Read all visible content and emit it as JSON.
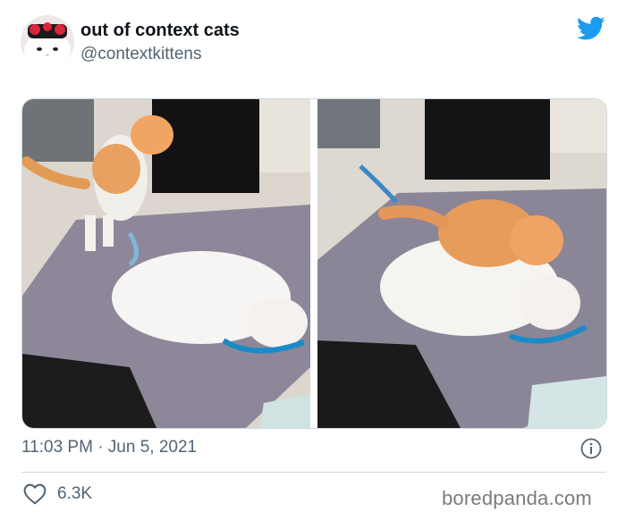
{
  "tweet": {
    "display_name": "out of context cats",
    "handle": "@contextkittens",
    "timestamp": "11:03 PM · Jun 5, 2021",
    "like_count": "6.3K"
  },
  "icons": {
    "brand": "twitter-bird-icon",
    "info": "info-circle-icon",
    "like": "heart-outline-icon"
  },
  "watermark": "boredpanda.com",
  "colors": {
    "twitter_blue": "#1d9bf0",
    "secondary_text": "#536471",
    "divider": "#cfd9de"
  }
}
